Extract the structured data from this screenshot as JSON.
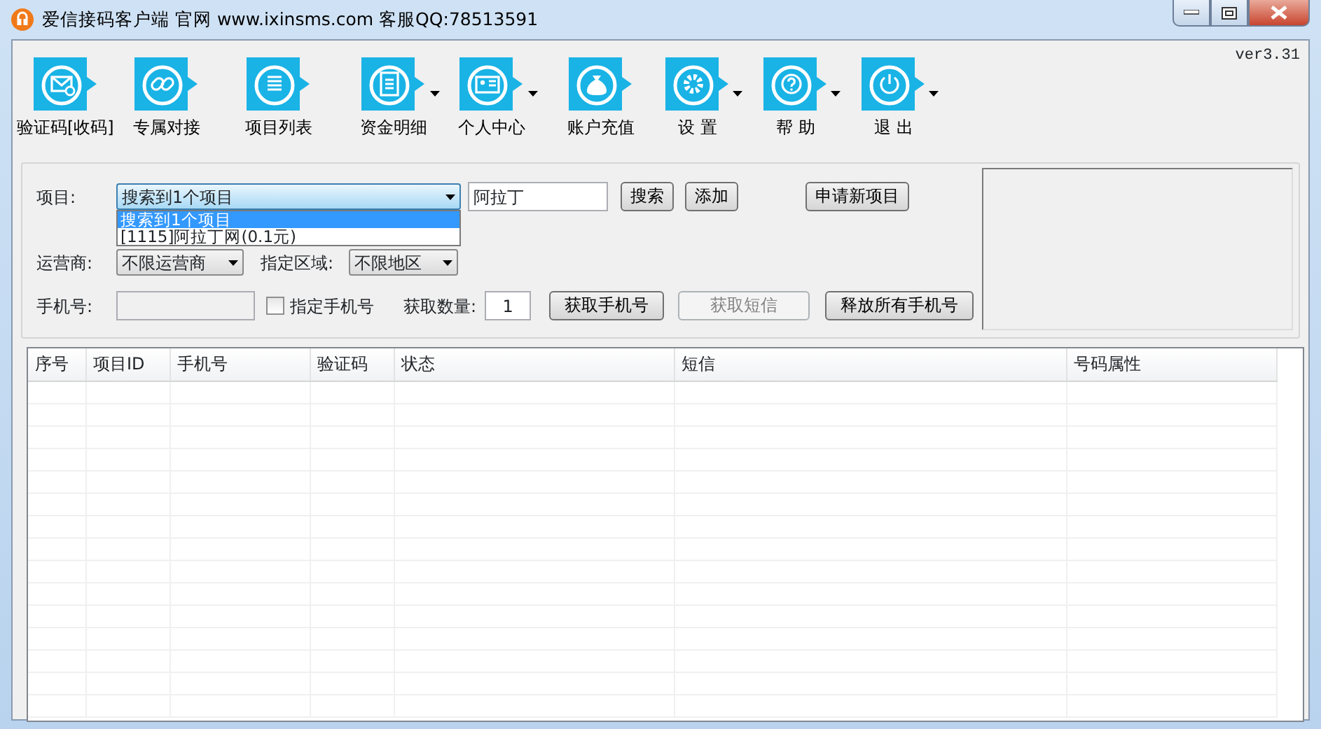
{
  "window": {
    "title": "爱信接码客户端   官网 www.ixinsms.com   客服QQ:78513591",
    "version": "ver3.31"
  },
  "toolbar": [
    {
      "label": "验证码[收码]",
      "has_menu": false
    },
    {
      "label": "专属对接",
      "has_menu": false
    },
    {
      "label": "项目列表",
      "has_menu": false
    },
    {
      "label": "资金明细",
      "has_menu": true
    },
    {
      "label": "个人中心",
      "has_menu": true
    },
    {
      "label": "账户充值",
      "has_menu": false
    },
    {
      "label": "设 置",
      "has_menu": true
    },
    {
      "label": "帮 助",
      "has_menu": true
    },
    {
      "label": "退 出",
      "has_menu": true
    }
  ],
  "form": {
    "project_label": "项目:",
    "project_value": "搜索到1个项目",
    "search_value": "阿拉丁",
    "search_button": "搜索",
    "add_button": "添加",
    "apply_button": "申请新项目",
    "dropdown": [
      {
        "text": "搜索到1个项目",
        "selected": true
      },
      {
        "text": "[1115]阿拉丁网(0.1元)",
        "selected": false
      }
    ],
    "carrier_label": "运营商:",
    "carrier_value": "不限运营商",
    "region_label": "指定区域:",
    "region_value": "不限地区",
    "phone_label": "手机号:",
    "phone_field": {
      "disabled": true
    },
    "specify_phone": {
      "label": "指定手机号",
      "checked": false
    },
    "count_label": "获取数量:",
    "count_value": "1",
    "buttons": [
      {
        "label": "获取手机号",
        "disabled": false
      },
      {
        "label": "获取短信",
        "disabled": true
      },
      {
        "label": "释放所有手机号",
        "disabled": false
      }
    ]
  },
  "table": {
    "columns": [
      "序号",
      "项目ID",
      "手机号",
      "验证码",
      "状态",
      "短信",
      "号码属性"
    ]
  }
}
